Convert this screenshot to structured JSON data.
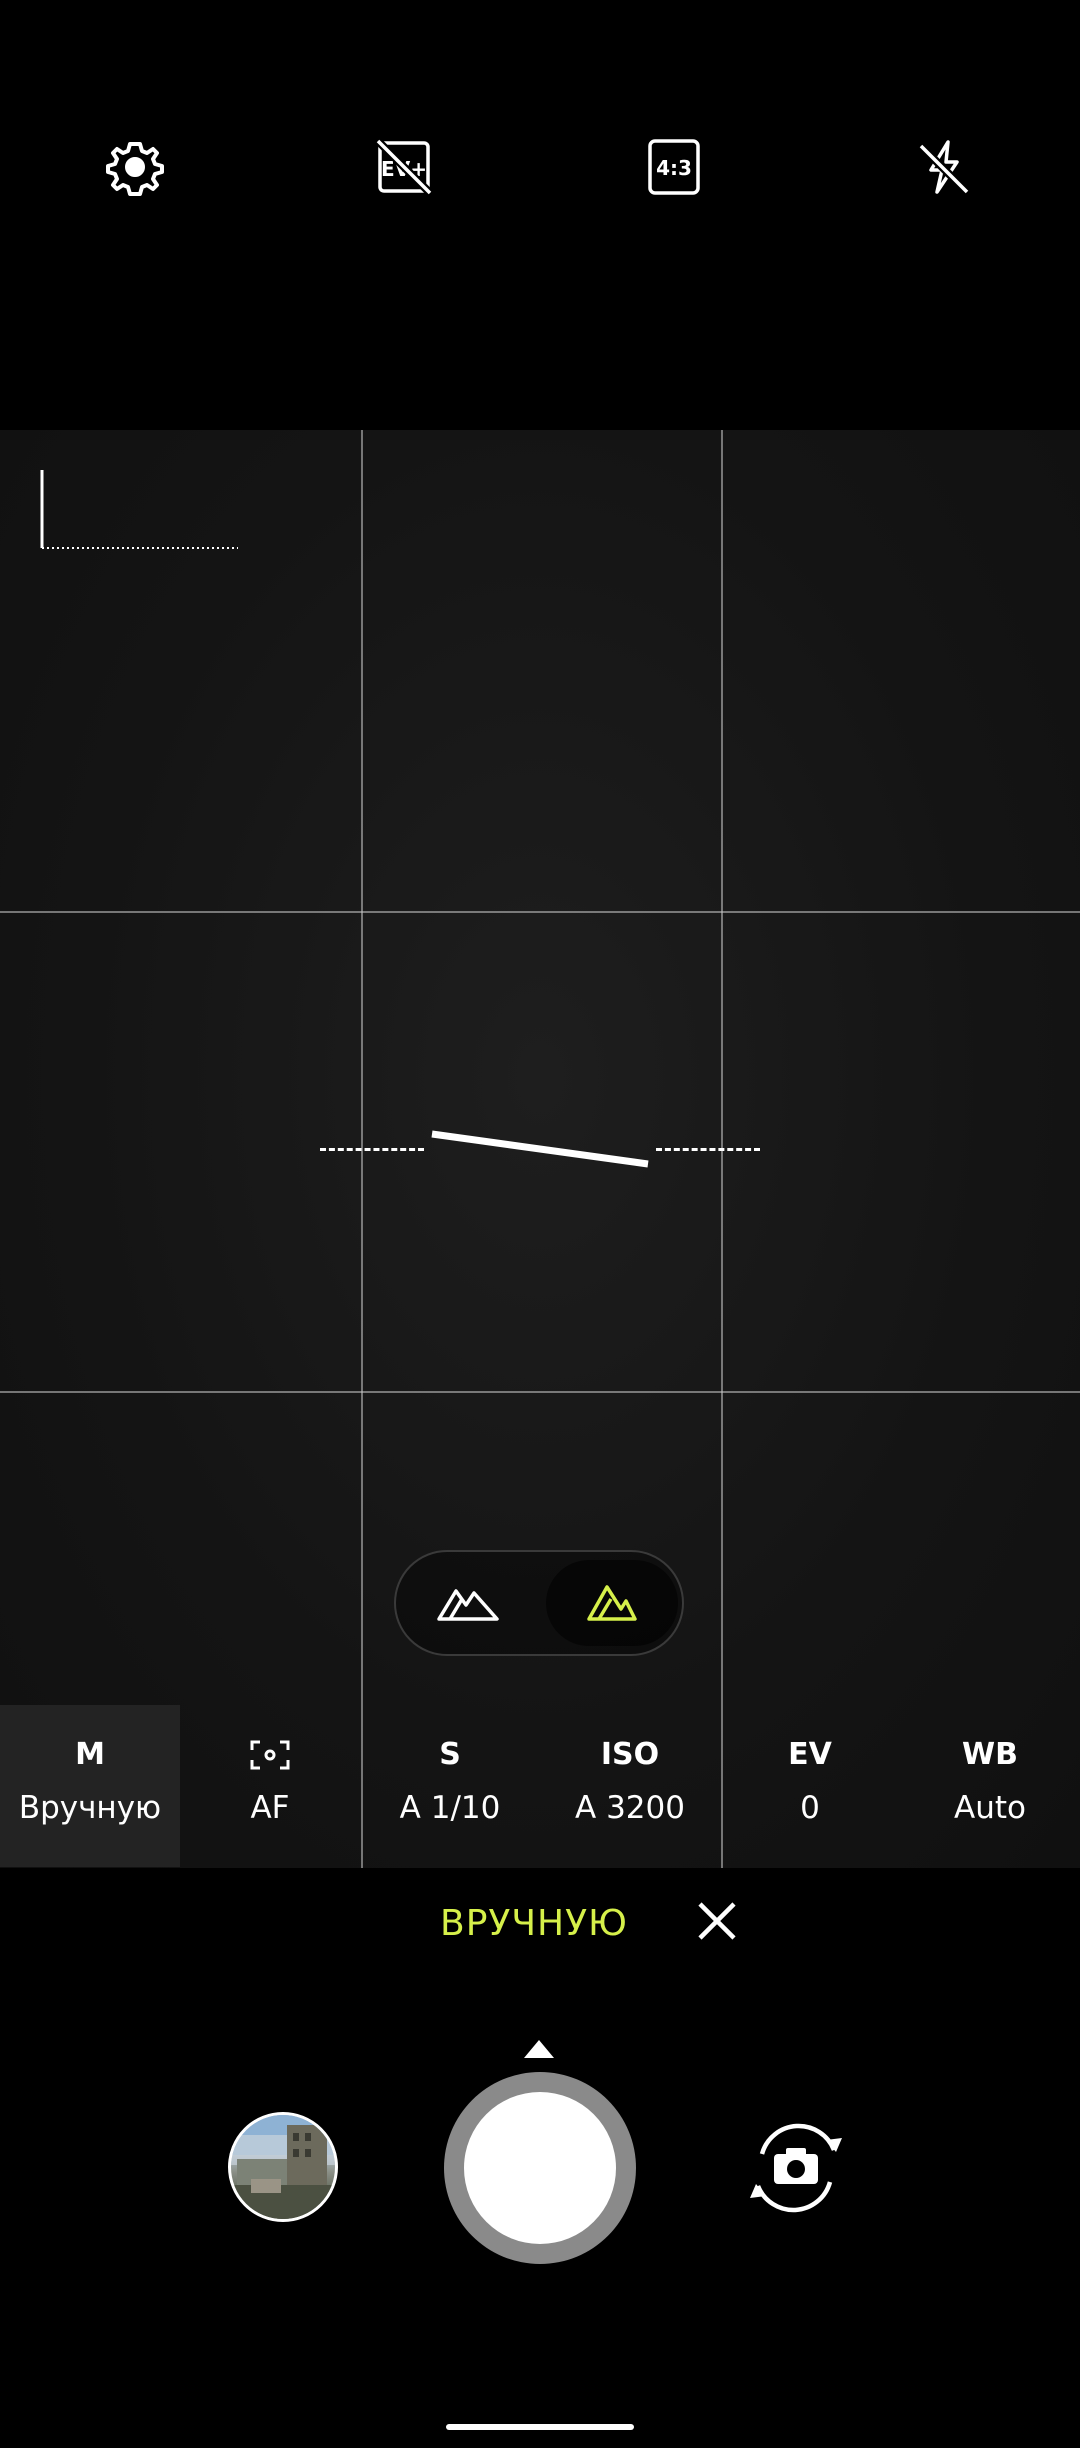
{
  "top_bar": {
    "icons": [
      "gear-icon",
      "ev-off-icon",
      "aspect-ratio-icon",
      "flash-off-icon"
    ],
    "aspect_ratio_label": "4:3",
    "ev_label": "EV+"
  },
  "viewfinder": {
    "lens_selector": {
      "options": [
        "wide-angle-lens-icon",
        "standard-lens-icon"
      ],
      "active": "standard-lens-icon"
    }
  },
  "settings_strip": {
    "mode": {
      "key": "M",
      "value": "Вручную"
    },
    "af": {
      "key_icon": "focus-frame-icon",
      "value": "AF"
    },
    "shutter": {
      "key": "S",
      "value": "A 1/10"
    },
    "iso": {
      "key": "ISO",
      "value": "A 3200"
    },
    "ev": {
      "key": "EV",
      "value": "0"
    },
    "wb": {
      "key": "WB",
      "value": "Auto"
    }
  },
  "mode_banner": {
    "label": "ВРУЧНУЮ"
  },
  "colors": {
    "accent": "#d6f04a",
    "background": "#000000",
    "strip_selected": "#232323"
  }
}
